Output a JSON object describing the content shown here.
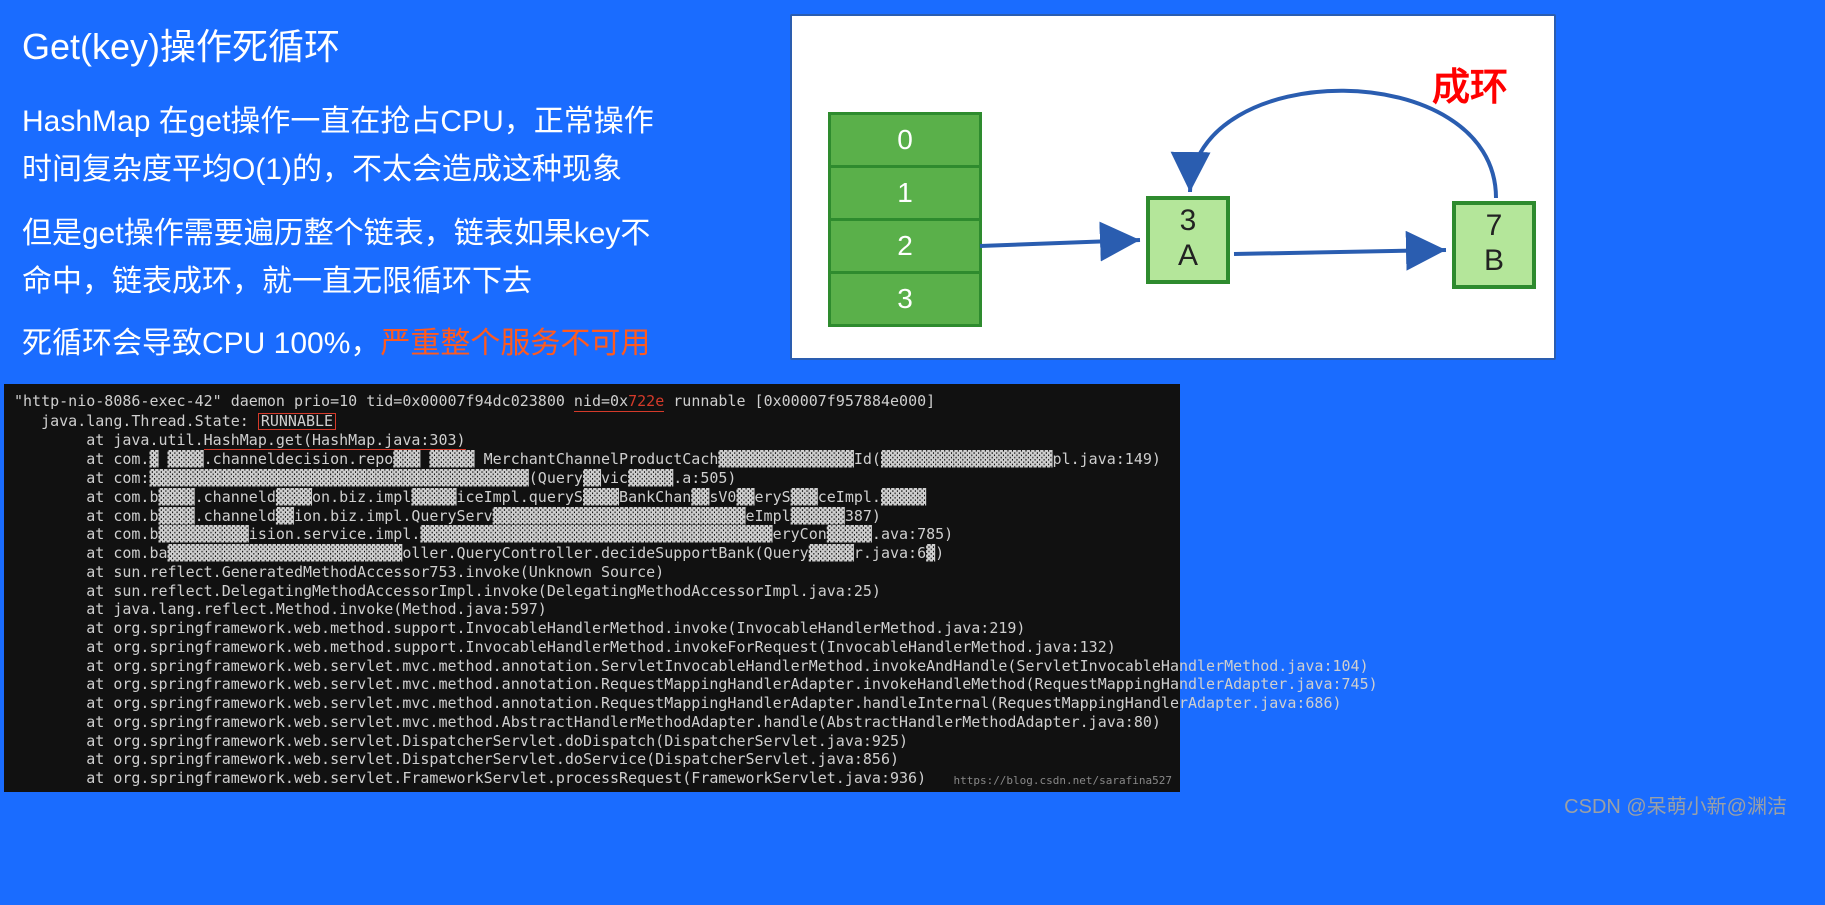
{
  "title": "Get(key)操作死循环",
  "paragraph1": "HashMap 在get操作一直在抢占CPU，正常操作时间复杂度平均O(1)的，不太会造成这种现象",
  "paragraph2": "但是get操作需要遍历整个链表，链表如果key不命中，链表成环，就一直无限循环下去",
  "paragraph3_prefix": "死循环会导致CPU 100%，",
  "paragraph3_warn": "严重整个服务不可用",
  "diagram": {
    "loop_label": "成环",
    "buckets": [
      "0",
      "1",
      "2",
      "3"
    ],
    "nodeA_line1": "3",
    "nodeA_line2": "A",
    "nodeB_line1": "7",
    "nodeB_line2": "B"
  },
  "stack": {
    "line1_a": "\"http-nio-8086-exec-42\" daemon prio=10 tid=0x00007f94dc023800 ",
    "line1_nid_label": "nid=0x",
    "line1_nid_val": "722e",
    "line1_b": " runnable [0x00007f957884e000]",
    "line2_a": "   java.lang.Thread.State: ",
    "line2_state": "RUNNABLE",
    "line3_a": "        at java.util.",
    "line3_b": "HashMap.get(HashMap.java:303)",
    "line4": "        at com.▓ ▓▓▓▓.channeldecision.repo▓▓▓ ▓▓▓▓▓ MerchantChannelProductCach▓▓▓▓▓▓▓▓▓▓▓▓▓▓▓Id(▓▓▓▓▓▓▓▓▓▓▓▓▓▓▓▓▓▓▓pl.java:149)",
    "line5": "        at com:▓▓▓▓▓▓▓▓▓▓▓▓▓▓▓▓▓▓▓▓▓▓▓▓▓▓▓▓▓▓▓▓▓▓▓▓▓▓▓▓▓▓(Query▓▓vic▓▓▓▓▓.a:505)",
    "line6": "        at com.b▓▓▓▓.channeld▓▓▓▓on.biz.impl▓▓▓▓▓iceImpl.queryS▓▓▓▓BankChan▓▓sV0▓▓eryS▓▓▓ceImpl.▓▓▓▓▓",
    "line7": "        at com.b▓▓▓▓.channeld▓▓ion.biz.impl.QueryServ▓▓▓▓▓▓▓▓▓▓▓▓▓▓▓▓▓▓▓▓▓▓▓▓▓▓▓▓eImpl▓▓▓▓▓▓387)",
    "line8": "        at com.b▓▓▓▓▓▓▓▓▓▓ision.service.impl.▓▓▓▓▓▓▓▓▓▓▓▓▓▓▓▓▓▓▓▓▓▓▓▓▓▓▓▓▓▓▓▓▓▓▓▓▓▓▓eryCon▓▓▓▓▓.ava:785)",
    "line9": "        at com.ba▓▓▓▓▓▓▓▓▓▓▓▓▓▓▓▓▓▓▓▓▓▓▓▓▓▓oller.QueryController.decideSupportBank(Query▓▓▓▓▓r.java:6▓)",
    "line10": "        at sun.reflect.GeneratedMethodAccessor753.invoke(Unknown Source)",
    "line11": "        at sun.reflect.DelegatingMethodAccessorImpl.invoke(DelegatingMethodAccessorImpl.java:25)",
    "line12": "        at java.lang.reflect.Method.invoke(Method.java:597)",
    "line13": "        at org.springframework.web.method.support.InvocableHandlerMethod.invoke(InvocableHandlerMethod.java:219)",
    "line14": "        at org.springframework.web.method.support.InvocableHandlerMethod.invokeForRequest(InvocableHandlerMethod.java:132)",
    "line15": "        at org.springframework.web.servlet.mvc.method.annotation.ServletInvocableHandlerMethod.invokeAndHandle(ServletInvocableHandlerMethod.java:104)",
    "line16": "        at org.springframework.web.servlet.mvc.method.annotation.RequestMappingHandlerAdapter.invokeHandleMethod(RequestMappingHandlerAdapter.java:745)",
    "line17": "        at org.springframework.web.servlet.mvc.method.annotation.RequestMappingHandlerAdapter.handleInternal(RequestMappingHandlerAdapter.java:686)",
    "line18": "        at org.springframework.web.servlet.mvc.method.AbstractHandlerMethodAdapter.handle(AbstractHandlerMethodAdapter.java:80)",
    "line19": "        at org.springframework.web.servlet.DispatcherServlet.doDispatch(DispatcherServlet.java:925)",
    "line20": "        at org.springframework.web.servlet.DispatcherServlet.doService(DispatcherServlet.java:856)",
    "line21": "        at org.springframework.web.servlet.FrameworkServlet.processRequest(FrameworkServlet.java:936)",
    "url": "https://blog.csdn.net/sarafina527"
  },
  "watermark": "CSDN @呆萌小新@渊洁"
}
